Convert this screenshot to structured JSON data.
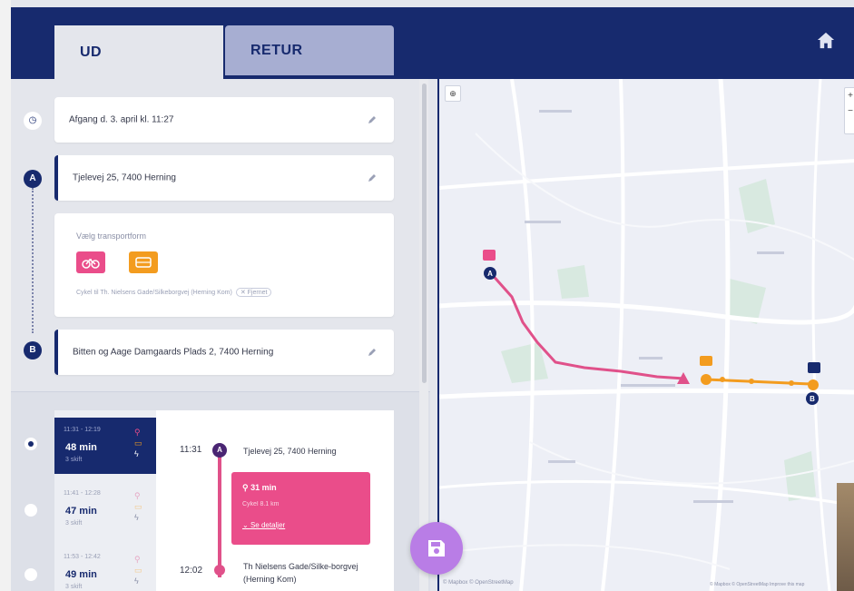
{
  "tabs": [
    {
      "label": "UD",
      "active": true
    },
    {
      "label": "RETUR",
      "active": false
    }
  ],
  "trip": {
    "departure": "Afgang d. 3. april kl. 11:27",
    "from": "Tjelevej 25, 7400 Herning",
    "to": "Bitten og Aage Damgaards Plads 2, 7400 Herning",
    "from_marker": "A",
    "to_marker": "B"
  },
  "transport": {
    "label": "Vælg transportform",
    "note": "Cykel til Th. Nielsens Gade/Silkeborgvej (Herning Kom)",
    "chip": "✕ Fjernet"
  },
  "options": [
    {
      "time": "11:31 - 12:19",
      "duration": "48 min",
      "sub": "3 skift",
      "selected": true
    },
    {
      "time": "11:41 - 12:28",
      "duration": "47 min",
      "sub": "3 skift",
      "selected": false
    },
    {
      "time": "11:53 - 12:42",
      "duration": "49 min",
      "sub": "3 skift",
      "selected": false
    }
  ],
  "detail": {
    "start_time": "11:31",
    "start_stop": "Tjelevej 25, 7400 Herning",
    "leg_duration": "31 min",
    "leg_sub": "Cykel 8.1 km",
    "leg_link": "Se detaljer",
    "end_time": "12:02",
    "end_stop": "Th Nielsens Gade/Silke-borgvej (Herning Kom)"
  },
  "map": {
    "compass": "⊕",
    "zoom_in": "+",
    "zoom_out": "−",
    "footer_left": "© Mapbox  © OpenStreetMap",
    "footer_right": "© Mapbox © OpenStreetMap Improve this map"
  },
  "colors": {
    "navy": "#172a6e",
    "pink": "#ea4d8a",
    "orange": "#f39c1f",
    "purple": "#b97de6"
  }
}
